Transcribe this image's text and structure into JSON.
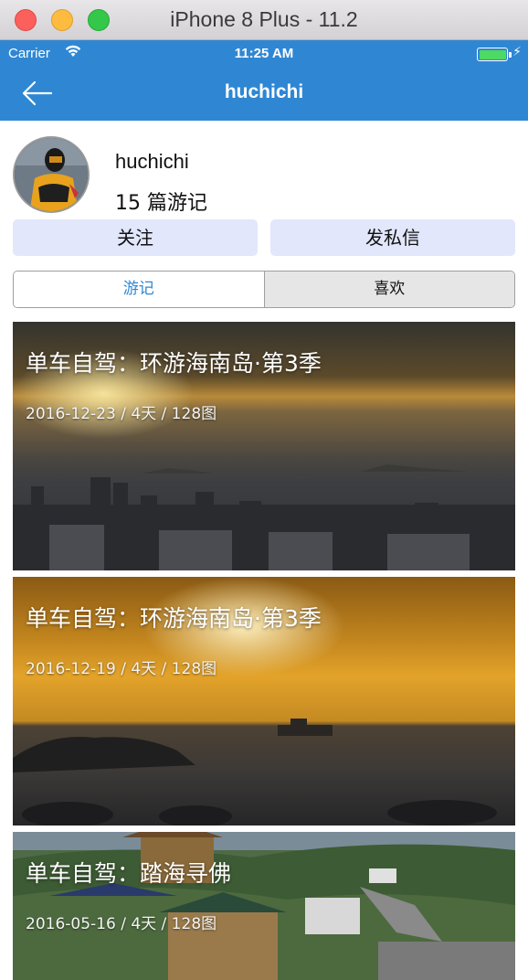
{
  "window": {
    "title": "iPhone 8 Plus - 11.2"
  },
  "status_bar": {
    "carrier": "Carrier",
    "time": "11:25 AM",
    "battery_level": 1.0
  },
  "nav": {
    "title": "huchichi"
  },
  "profile": {
    "username": "huchichi",
    "travel_count": "15 篇游记",
    "follow_label": "关注",
    "message_label": "发私信"
  },
  "tabs": [
    {
      "label": "游记",
      "active": true
    },
    {
      "label": "喜欢",
      "active": false
    }
  ],
  "cards": [
    {
      "title": "单车自驾：环游海南岛·第3季",
      "meta": "2016-12-23 / 4天 / 128图"
    },
    {
      "title": "单车自驾：环游海南岛·第3季",
      "meta": "2016-12-19 / 4天 / 128图"
    },
    {
      "title": "单车自驾：踏海寻佛",
      "meta": "2016-05-16 / 4天 / 128图"
    }
  ],
  "colors": {
    "nav_blue": "#2f87d3",
    "button_bg": "#e2e7fb",
    "active_tab_text": "#2f87d3"
  }
}
